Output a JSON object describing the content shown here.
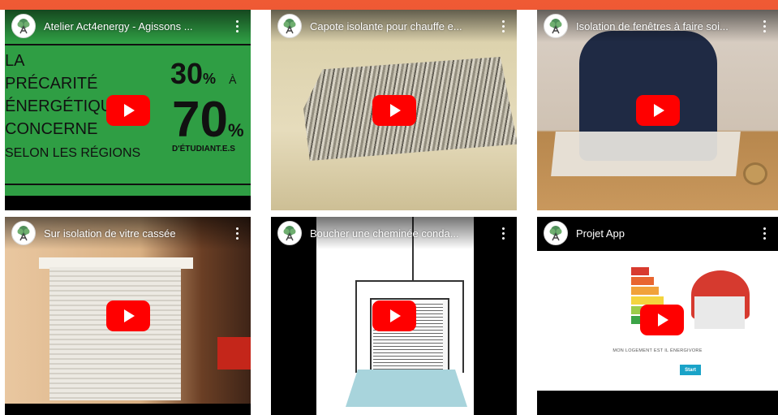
{
  "videos": [
    {
      "title": "Atelier Act4energy - Agissons ..."
    },
    {
      "title": "Capote isolante pour chauffe e..."
    },
    {
      "title": "Isolation de fenêtres à faire soi..."
    },
    {
      "title": "Sur isolation de vitre cassée"
    },
    {
      "title": "Boucher une cheminée conda..."
    },
    {
      "title": "Projet App"
    }
  ],
  "poster": {
    "line1": "LA",
    "line2": "PRÉCARITÉ",
    "line3": "ÉNERGÉTIQUE",
    "line4": "CONCERNE",
    "line5": "SELON LES RÉGIONS",
    "pct1": "30",
    "pct1_unit": "%",
    "to": "À",
    "pct2": "70",
    "pct2_unit": "%",
    "students": "D'ÉTUDIANT.E.S"
  },
  "app_preview": {
    "caption": "MON LOGEMENT EST IL ÉNERGIVORE",
    "start_label": "Start"
  },
  "colors": {
    "frame_orange": "#e8432e",
    "poster_green": "#2f9e44",
    "play_red": "#ff0000",
    "start_blue": "#1aa3c8"
  }
}
